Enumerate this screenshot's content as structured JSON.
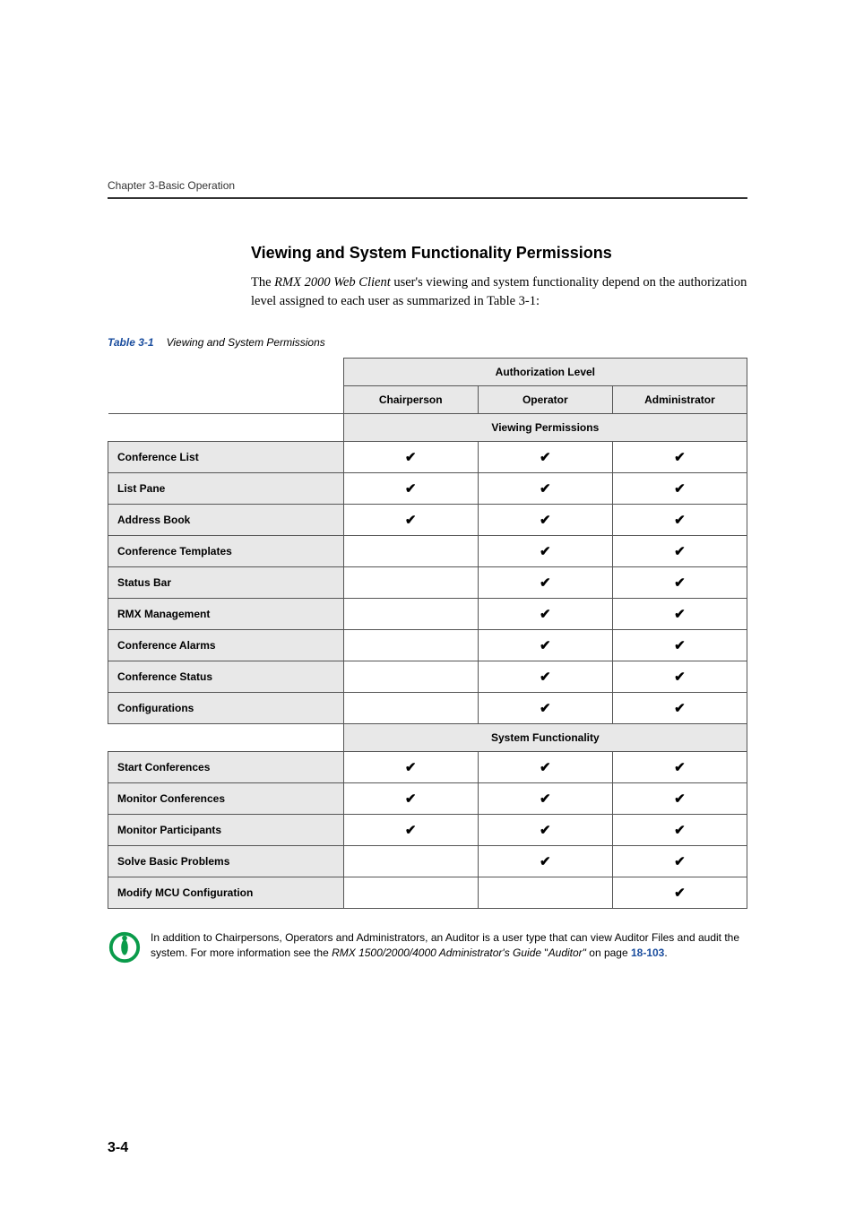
{
  "header": {
    "chapter": "Chapter 3-Basic Operation"
  },
  "section": {
    "heading": "Viewing and System Functionality Permissions",
    "intro_pre": "The ",
    "intro_italic": "RMX 2000 Web Client",
    "intro_post": " user's viewing and system functionality depend on the authorization level assigned to each user as summarized in Table 3-1:"
  },
  "table": {
    "caption_label": "Table 3-1",
    "caption_text": "Viewing and System Permissions",
    "header_top": "Authorization Level",
    "cols": [
      "Chairperson",
      "Operator",
      "Administrator"
    ],
    "section1": "Viewing Permissions",
    "section2": "System Functionality",
    "rows1": [
      {
        "label": "Conference List",
        "c": true,
        "o": true,
        "a": true
      },
      {
        "label": "List Pane",
        "c": true,
        "o": true,
        "a": true
      },
      {
        "label": "Address Book",
        "c": true,
        "o": true,
        "a": true
      },
      {
        "label": "Conference Templates",
        "c": false,
        "o": true,
        "a": true
      },
      {
        "label": "Status Bar",
        "c": false,
        "o": true,
        "a": true
      },
      {
        "label": "RMX Management",
        "c": false,
        "o": true,
        "a": true
      },
      {
        "label": "Conference Alarms",
        "c": false,
        "o": true,
        "a": true
      },
      {
        "label": "Conference Status",
        "c": false,
        "o": true,
        "a": true
      },
      {
        "label": "Configurations",
        "c": false,
        "o": true,
        "a": true
      }
    ],
    "rows2": [
      {
        "label": "Start Conferences",
        "c": true,
        "o": true,
        "a": true
      },
      {
        "label": "Monitor Conferences",
        "c": true,
        "o": true,
        "a": true
      },
      {
        "label": "Monitor Participants",
        "c": true,
        "o": true,
        "a": true
      },
      {
        "label": "Solve Basic Problems",
        "c": false,
        "o": true,
        "a": true
      },
      {
        "label": "Modify MCU Configuration",
        "c": false,
        "o": false,
        "a": true
      }
    ]
  },
  "note": {
    "pre": "In addition to Chairpersons, Operators and Administrators, an Auditor is a user type that can view Auditor Files and audit the system. For more information see the ",
    "italic1": "RMX 1500/2000/4000 Administrator's Guide",
    "mid": " \"",
    "italic2": "Auditor\"",
    "post": " on page ",
    "link": "18-103",
    "end": "."
  },
  "footer": {
    "page_number": "3-4"
  },
  "glyph": {
    "check": "✔"
  }
}
